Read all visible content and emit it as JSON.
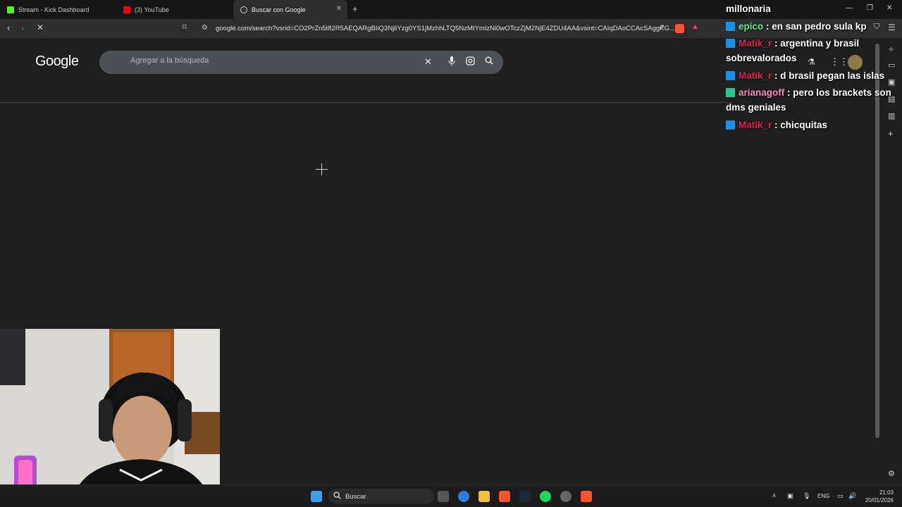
{
  "tabs": [
    {
      "label": "Stream - Kick Dashboard",
      "favicon": "kick-icon",
      "color": "#53fc18"
    },
    {
      "label": "(3) YouTube",
      "favicon": "youtube-icon",
      "color": "#ff0000"
    },
    {
      "label": "Buscar con Google",
      "favicon": "globe-icon",
      "active": true
    }
  ],
  "address": {
    "url": "google.com/search?vsrid=CO2PrZn5t82R5AEQARgBIiQ3NjliYzg0YS1jMzhhLTQ5NzMtYmIzNi0wOTczZjM2NjE4ZDU4AA&vsint=CAIqDAoCCAcSAggKG..."
  },
  "google": {
    "logo": "Google",
    "search_placeholder": "Agregar a la búsqueda"
  },
  "chat": {
    "header": "millonaria",
    "messages": [
      {
        "user": "epico",
        "user_color": "green",
        "text": ": en san pedro sula kp"
      },
      {
        "user": "Matik_r",
        "user_color": "red",
        "text": ": argentina y brasil sobrevalorados"
      },
      {
        "user": "Matik_r",
        "user_color": "red",
        "text": ": d brasil pegan las islas"
      },
      {
        "user": "arianagoff",
        "user_color": "pink",
        "text": ": pero los brackets son dms geniales"
      },
      {
        "user": "Matik_r",
        "user_color": "red",
        "text": ": chicquitas"
      }
    ]
  },
  "taskbar": {
    "search_label": "Buscar",
    "language": "ENG",
    "time": "21:03",
    "date": "20/01/2026"
  }
}
